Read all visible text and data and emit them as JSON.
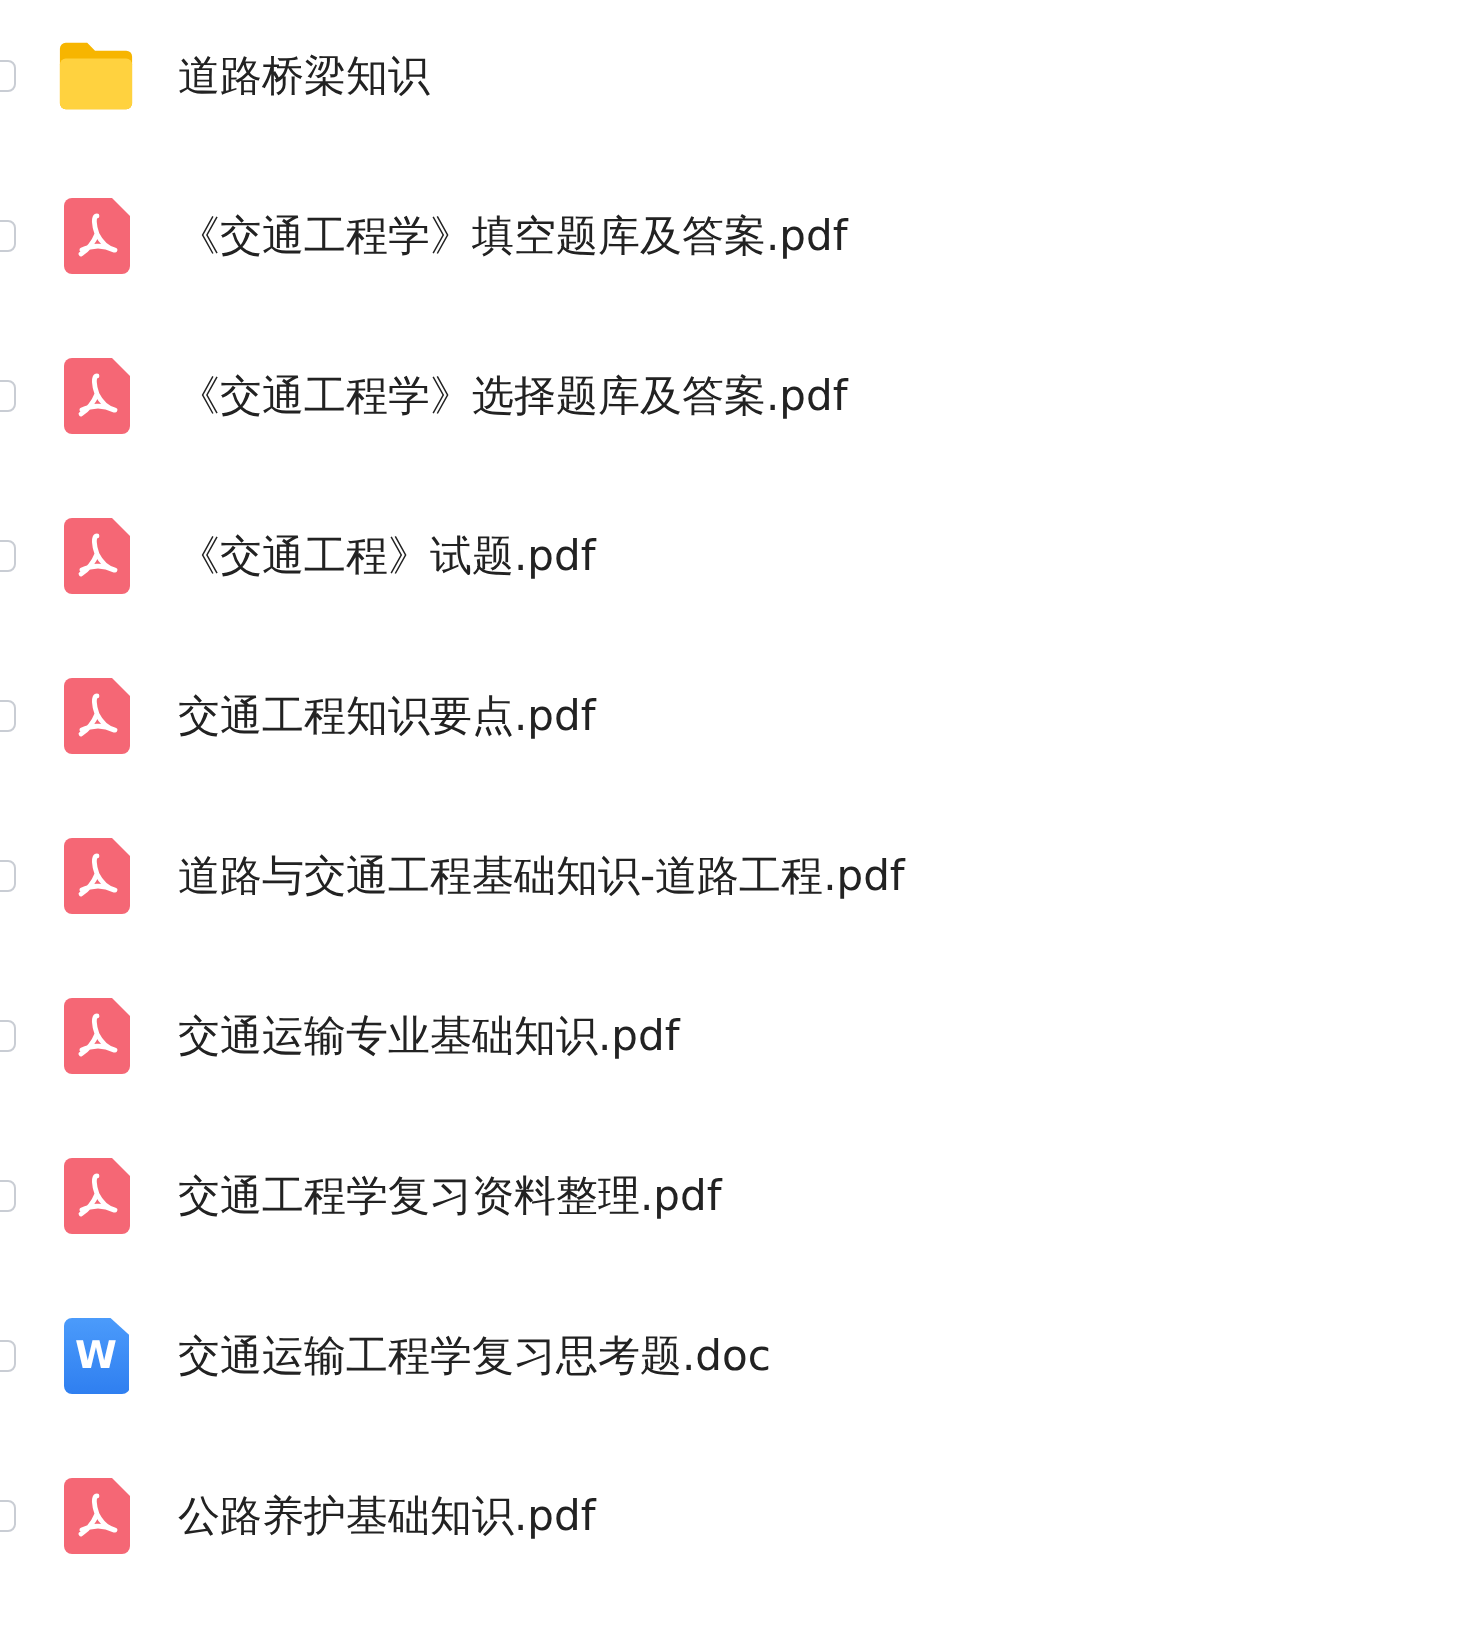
{
  "files": [
    {
      "kind": "folder",
      "name": "道路桥梁知识",
      "checked": false
    },
    {
      "kind": "pdf",
      "name": "《交通工程学》填空题库及答案.pdf",
      "checked": false
    },
    {
      "kind": "pdf",
      "name": "《交通工程学》选择题库及答案.pdf",
      "checked": false
    },
    {
      "kind": "pdf",
      "name": "《交通工程》试题.pdf",
      "checked": false
    },
    {
      "kind": "pdf",
      "name": "交通工程知识要点.pdf",
      "checked": false
    },
    {
      "kind": "pdf",
      "name": "道路与交通工程基础知识-道路工程.pdf",
      "checked": false
    },
    {
      "kind": "pdf",
      "name": "交通运输专业基础知识.pdf",
      "checked": false
    },
    {
      "kind": "pdf",
      "name": "交通工程学复习资料整理.pdf",
      "checked": false
    },
    {
      "kind": "doc",
      "name": "交通运输工程学复习思考题.doc",
      "checked": false,
      "icon_glyph": "W"
    },
    {
      "kind": "pdf",
      "name": "公路养护基础知识.pdf",
      "checked": false
    }
  ]
}
